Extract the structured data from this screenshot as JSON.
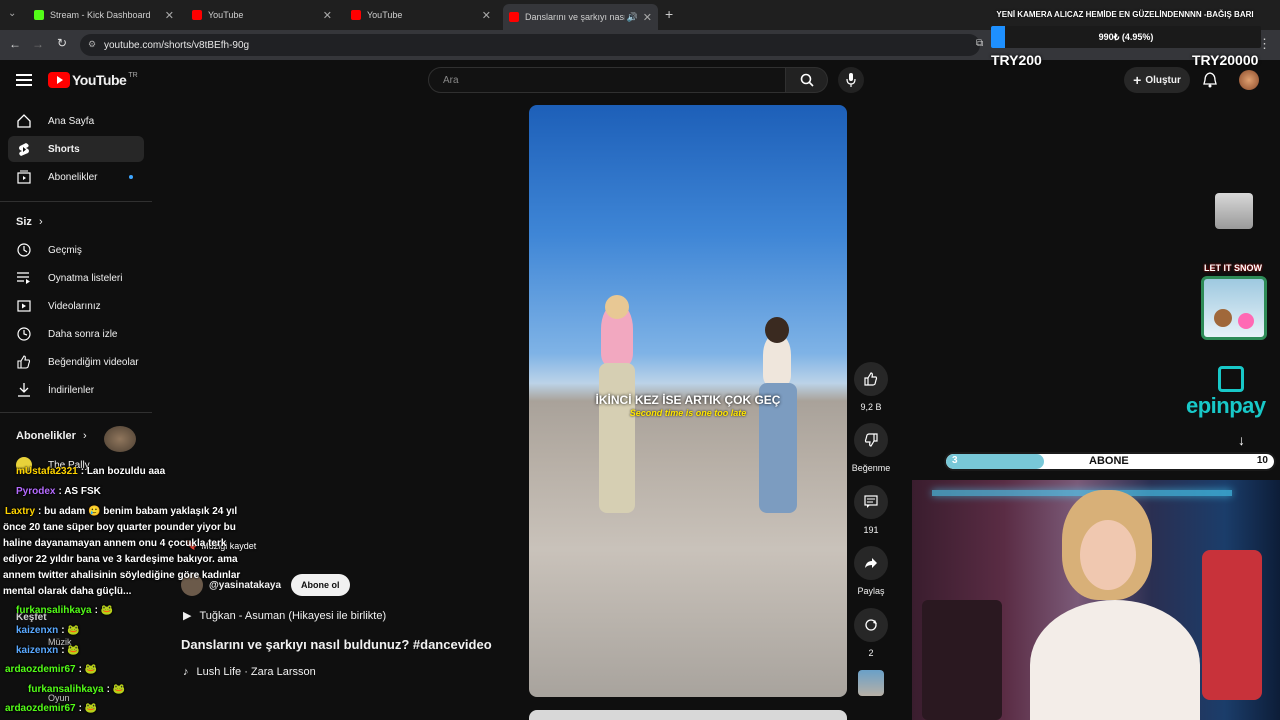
{
  "browser": {
    "tabs": [
      {
        "title": "Stream - Kick Dashboard",
        "favicon_color": "#53fc18"
      },
      {
        "title": "YouTube",
        "favicon_color": "#ff0000"
      },
      {
        "title": "YouTube",
        "favicon_color": "#ff0000"
      },
      {
        "title": "Danslarını ve şarkıyı nasıl b",
        "favicon_color": "#ff0000"
      }
    ],
    "url": "youtube.com/shorts/v8tBEfh-90g"
  },
  "youtube": {
    "logo_text": "YouTube",
    "logo_region": "TR",
    "search_placeholder": "Ara",
    "create_label": "Oluştur"
  },
  "sidebar": {
    "main_items": [
      {
        "label": "Ana Sayfa",
        "icon": "home-icon"
      },
      {
        "label": "Shorts",
        "icon": "shorts-icon",
        "active": true
      },
      {
        "label": "Abonelikler",
        "icon": "subscriptions-icon"
      }
    ],
    "you_heading": "Siz",
    "you_items": [
      {
        "label": "Geçmiş",
        "icon": "history-icon"
      },
      {
        "label": "Oynatma listeleri",
        "icon": "playlist-icon"
      },
      {
        "label": "Videolarınız",
        "icon": "your-videos-icon"
      },
      {
        "label": "Daha sonra izle",
        "icon": "watch-later-icon"
      },
      {
        "label": "Beğendiğim videolar",
        "icon": "liked-icon"
      },
      {
        "label": "İndirilenler",
        "icon": "download-icon"
      }
    ],
    "subs_heading": "Abonelikler",
    "subs_items": [
      "The Pally"
    ],
    "explore_heading": "Keşfet",
    "explore_items": [
      "Müzik",
      "Oyun"
    ]
  },
  "video": {
    "caption_tr": "İKİNCİ KEZ İSE ARTIK ÇOK GEÇ",
    "caption_en": "Second time is one too late",
    "save_music_label": "Müziği kaydet",
    "channel": "@yasinatakaya",
    "subscribe_label": "Abone ol",
    "song_line": "Tuğkan - Asuman (Hikayesi ile birlikte)",
    "title": "Danslarını ve şarkıyı nasıl buldunuz? #dancevideo",
    "sound": "Lush Life · Zara Larsson"
  },
  "actions": {
    "like_count": "9,2 B",
    "dislike_label": "Beğenme",
    "comment_count": "191",
    "share_label": "Paylaş",
    "remix_count": "2"
  },
  "chat": [
    {
      "user": "mUstafa2321",
      "color": "#ffd400",
      "text": ": Lan bozuldu aaa"
    },
    {
      "user": "Pyrodex",
      "color": "#b56bff",
      "text": ": AS FSK"
    },
    {
      "user": "Laxtry",
      "color": "#ffd400",
      "text": ": bu adam 🥲 benim babam yaklaşık 24 yıl"
    },
    {
      "user": "",
      "color": "#ffffff",
      "text": "önce 20 tane süper boy quarter pounder yiyor bu"
    },
    {
      "user": "",
      "color": "#ffffff",
      "text": "haline dayanamayan annem onu 4 çocukla terk"
    },
    {
      "user": "",
      "color": "#ffffff",
      "text": "ediyor 22 yıldır bana ve 3 kardeşime bakıyor. ama"
    },
    {
      "user": "",
      "color": "#ffffff",
      "text": "annem twitter ahalisinin söylediğine göre kadınlar"
    },
    {
      "user": "",
      "color": "#ffffff",
      "text": "mental olarak daha güçlü..."
    },
    {
      "user": "furkansalihkaya",
      "color": "#53fc18",
      "text": ": 🐸"
    },
    {
      "user": "kaizenxn",
      "color": "#5aa9ff",
      "text": ": 🐸"
    },
    {
      "user": "kaizenxn",
      "color": "#5aa9ff",
      "text": ": 🐸"
    },
    {
      "user": "ardaozdemir67",
      "color": "#53fc18",
      "text": ": 🐸"
    },
    {
      "user": "furkansalihkaya",
      "color": "#53fc18",
      "text": ": 🐸"
    },
    {
      "user": "ardaozdemir67",
      "color": "#53fc18",
      "text": ": 🐸"
    }
  ],
  "overlay": {
    "goal_text": "YENİ KAMERA ALICAZ HEMİDE EN GÜZELİNDENNNN -BAĞIŞ BARI",
    "goal_progress": "990₺ (4.95%)",
    "goal_fraction": 0.0495,
    "goal_min": "TRY200",
    "goal_max": "TRY20000",
    "sub_goal_label": "ABONE",
    "sub_current": "3",
    "sub_target": "10",
    "sub_fraction": 0.3,
    "let_it_snow": "LET IT SNOW",
    "sponsor": "epinpay"
  }
}
